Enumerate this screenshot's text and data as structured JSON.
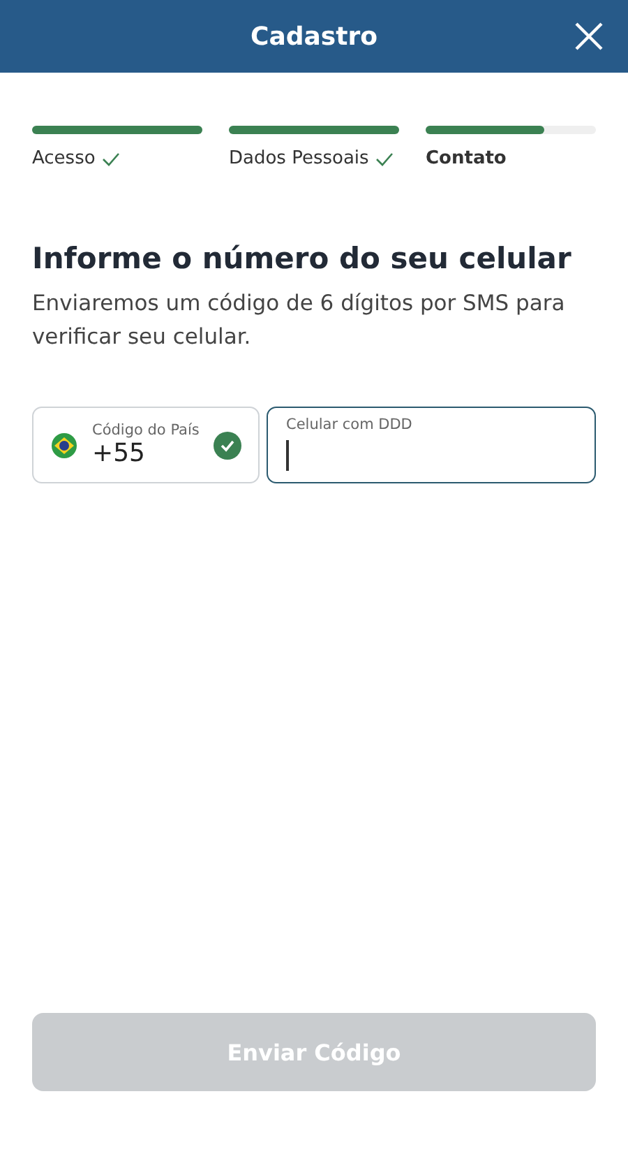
{
  "header": {
    "title": "Cadastro"
  },
  "steps": [
    {
      "label": "Acesso",
      "level": 1,
      "done": true,
      "current": false
    },
    {
      "label": "Dados Pessoais",
      "level": 1,
      "done": true,
      "current": false
    },
    {
      "label": "Contato",
      "level": 0.7,
      "done": false,
      "current": true
    }
  ],
  "heading": "Informe o número do seu celular",
  "description": "Enviaremos um código de 6 dígitos por SMS para verificar seu celular.",
  "country_field": {
    "label": "Código do País",
    "value": "+55",
    "valid": true
  },
  "phone_field": {
    "placeholder": "Celular com DDD",
    "focused": true
  },
  "submit_button": {
    "label": "Enviar Código",
    "disabled": true
  }
}
